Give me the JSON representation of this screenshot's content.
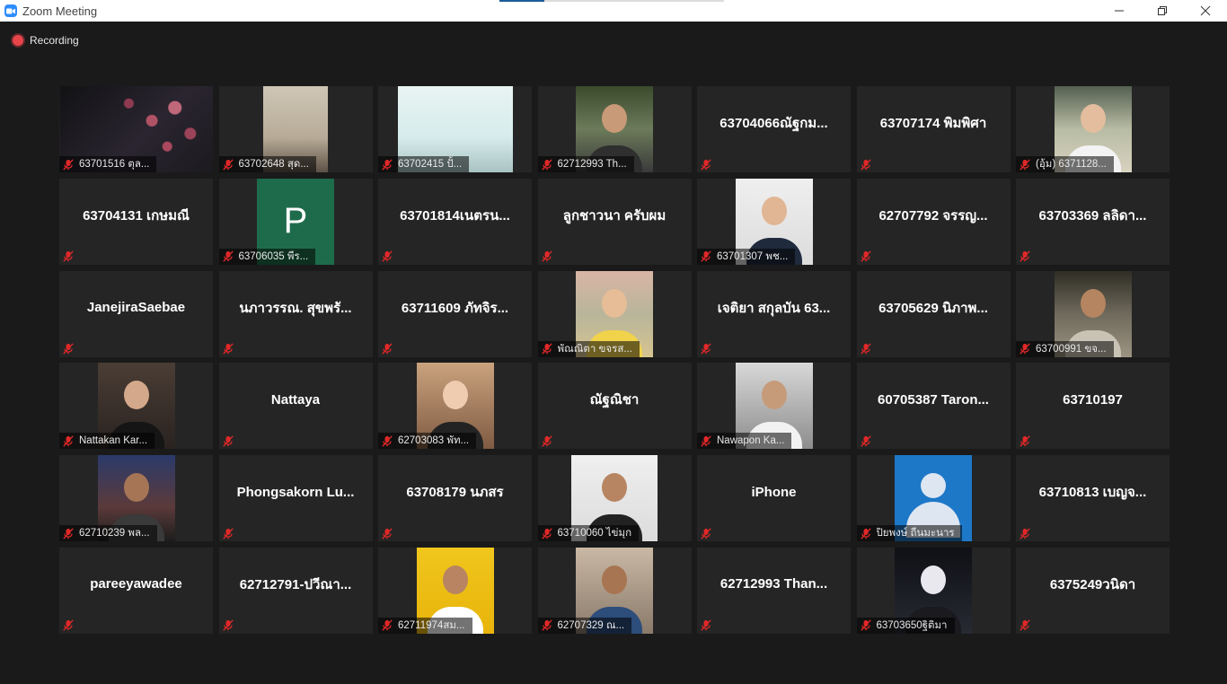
{
  "window": {
    "title": "Zoom Meeting",
    "accent_color": "#2d8cff"
  },
  "recording": {
    "label": "Recording",
    "color": "#e8454b"
  },
  "participants": [
    {
      "name": "63701516 ตุล...",
      "video": "flowers",
      "muted": true,
      "show_label": true
    },
    {
      "name": "63702648 สุด...",
      "video": "room",
      "muted": true,
      "show_label": true
    },
    {
      "name": "63702415 ปั้...",
      "video": "ceiling",
      "muted": true,
      "show_label": true
    },
    {
      "name": "62712993 Th...",
      "video": "plant",
      "muted": true,
      "show_label": true
    },
    {
      "name": "63704066ณัฐกม...",
      "video": "",
      "muted": true,
      "show_label": false
    },
    {
      "name": "63707174 พิมพิศา",
      "video": "",
      "muted": true,
      "show_label": false
    },
    {
      "name": "(อุ้ม) 6371128...",
      "video": "shop",
      "muted": true,
      "show_label": true
    },
    {
      "name": "63704131 เกษมณี",
      "video": "",
      "muted": true,
      "show_label": false
    },
    {
      "name": "63706035 พีร...",
      "video": "letter-p",
      "letter": "P",
      "muted": true,
      "show_label": true
    },
    {
      "name": "63701814เนตรน...",
      "video": "",
      "muted": true,
      "show_label": false
    },
    {
      "name": "ลูกชาวนา ครับผม",
      "video": "",
      "muted": true,
      "show_label": false
    },
    {
      "name": "63701307 พช...",
      "video": "white",
      "muted": true,
      "show_label": true
    },
    {
      "name": "62707792 จรรญ...",
      "video": "",
      "muted": true,
      "show_label": false
    },
    {
      "name": "63703369 ลลิดา...",
      "video": "",
      "muted": true,
      "show_label": false
    },
    {
      "name": "JanejiraSaebae",
      "video": "",
      "muted": true,
      "show_label": false
    },
    {
      "name": "นภาวรรณ. สุขพรั...",
      "video": "",
      "muted": true,
      "show_label": false
    },
    {
      "name": "63711609 ภัทจิร...",
      "video": "",
      "muted": true,
      "show_label": false
    },
    {
      "name": "พัณณิตา ขจรส...",
      "video": "flowerwall",
      "muted": true,
      "show_label": true
    },
    {
      "name": "เจติยา สกุลบัน 63...",
      "video": "",
      "muted": true,
      "show_label": false
    },
    {
      "name": "63705629 นิภาพ...",
      "video": "",
      "muted": true,
      "show_label": false
    },
    {
      "name": "63700991 ขจ...",
      "video": "classroom",
      "muted": true,
      "show_label": true
    },
    {
      "name": "Nattakan Kar...",
      "video": "dark-room",
      "muted": true,
      "show_label": true
    },
    {
      "name": "Nattaya",
      "video": "",
      "muted": true,
      "show_label": false
    },
    {
      "name": "62703083 พัท...",
      "video": "cafe",
      "muted": true,
      "show_label": true
    },
    {
      "name": "ณัฐณิชา",
      "video": "",
      "muted": true,
      "show_label": false
    },
    {
      "name": "Nawapon Ka...",
      "video": "street",
      "muted": true,
      "show_label": true
    },
    {
      "name": "60705387 Taron...",
      "video": "",
      "muted": true,
      "show_label": false
    },
    {
      "name": "63710197",
      "video": "",
      "muted": true,
      "show_label": false
    },
    {
      "name": "62710239 พล...",
      "video": "night",
      "muted": true,
      "show_label": true
    },
    {
      "name": "Phongsakorn  Lu...",
      "video": "",
      "muted": true,
      "show_label": false
    },
    {
      "name": "63708179 นภสร",
      "video": "",
      "muted": true,
      "show_label": false
    },
    {
      "name": "63710060 ไข่มุก",
      "video": "white-wide",
      "muted": true,
      "show_label": true
    },
    {
      "name": "iPhone",
      "video": "",
      "muted": true,
      "show_label": false
    },
    {
      "name": "ปิยพงษ์ ถีนมะนาร",
      "video": "avatar",
      "muted": true,
      "show_label": true
    },
    {
      "name": "63710813 เบญจ...",
      "video": "",
      "muted": true,
      "show_label": false
    },
    {
      "name": "pareeyawadee",
      "video": "",
      "muted": true,
      "show_label": false
    },
    {
      "name": "62712791-ปวีณา...",
      "video": "",
      "muted": true,
      "show_label": false
    },
    {
      "name": "62711974สม...",
      "video": "yellow",
      "muted": true,
      "show_label": true
    },
    {
      "name": "62707329 ณ...",
      "video": "market",
      "muted": true,
      "show_label": true
    },
    {
      "name": "62712993 Than...",
      "video": "",
      "muted": true,
      "show_label": false
    },
    {
      "name": "63703650ฐิติมา",
      "video": "anime",
      "muted": true,
      "show_label": true
    },
    {
      "name": "6375249วนิดา",
      "video": "",
      "muted": true,
      "show_label": false
    }
  ]
}
